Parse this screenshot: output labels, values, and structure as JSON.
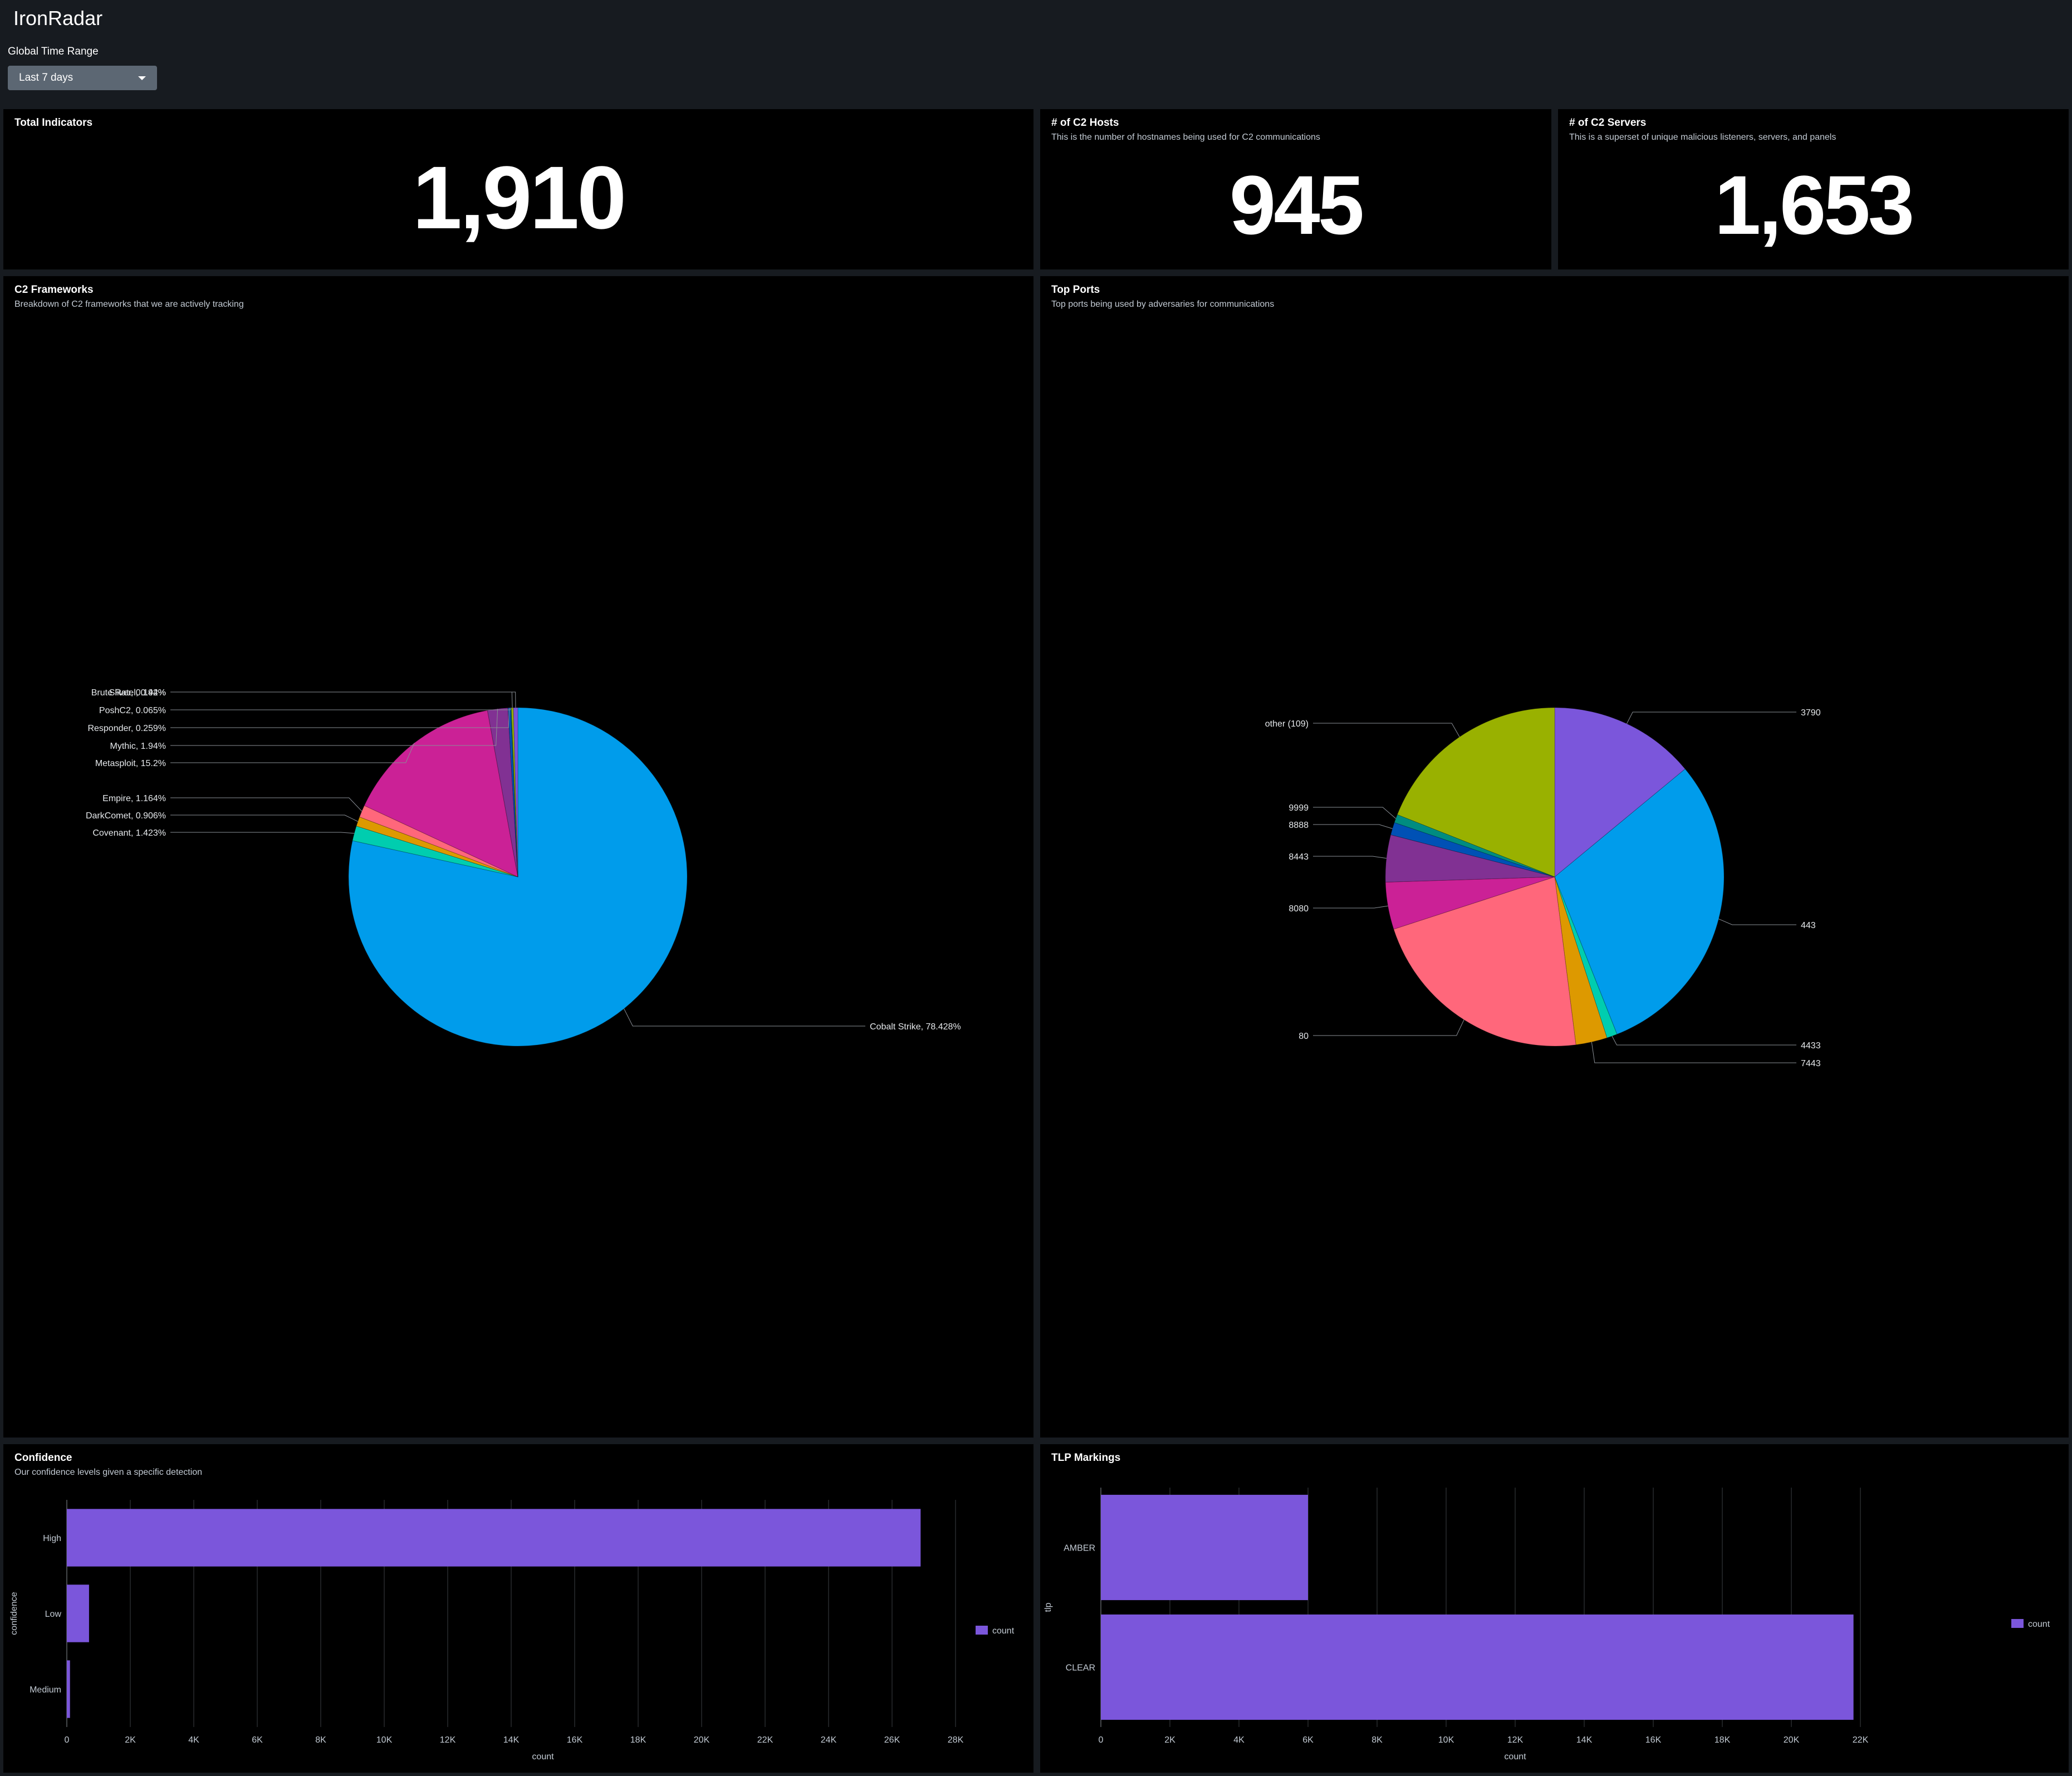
{
  "app": {
    "title": "IronRadar"
  },
  "time_range": {
    "label": "Global Time Range",
    "value": "Last 7 days"
  },
  "kpis": {
    "total_indicators": {
      "title": "Total Indicators",
      "value": "1,910"
    },
    "c2_hosts": {
      "title": "# of C2 Hosts",
      "description": "This is the number of hostnames being used for C2 communications",
      "value": "945"
    },
    "c2_servers": {
      "title": "# of C2 Servers",
      "description": "This is a superset of unique malicious listeners, servers, and panels",
      "value": "1,653"
    }
  },
  "panels": {
    "frameworks": {
      "title": "C2 Frameworks",
      "description": "Breakdown of C2 frameworks that we are actively tracking"
    },
    "ports": {
      "title": "Top Ports",
      "description": "Top ports being used by adversaries for communications"
    },
    "confidence": {
      "title": "Confidence",
      "description": "Our confidence levels given a specific detection"
    },
    "tlp": {
      "title": "TLP Markings"
    }
  },
  "chart_data": [
    {
      "id": "frameworks",
      "type": "pie",
      "slices": [
        {
          "label": "Cobalt Strike, 78.428%",
          "value": 78.428,
          "color": "#009ceb"
        },
        {
          "label": "Covenant, 1.423%",
          "value": 1.423,
          "color": "#00cdaf"
        },
        {
          "label": "DarkComet, 0.906%",
          "value": 0.906,
          "color": "#dd9900"
        },
        {
          "label": "Empire, 1.164%",
          "value": 1.164,
          "color": "#ff677b"
        },
        {
          "label": "Metasploit, 15.2%",
          "value": 15.2,
          "color": "#cb2196"
        },
        {
          "label": "Mythic, 1.94%",
          "value": 1.94,
          "color": "#813193"
        },
        {
          "label": "Responder, 0.259%",
          "value": 0.259,
          "color": "#0051b5"
        },
        {
          "label": "PoshC2, 0.065%",
          "value": 0.065,
          "color": "#008c80"
        },
        {
          "label": "Sliver, 0.194%",
          "value": 0.194,
          "color": "#99b100"
        },
        {
          "label": "Brute Ratel, 0.42%",
          "value": 0.42,
          "color": "#7b56db"
        }
      ]
    },
    {
      "id": "ports",
      "type": "pie",
      "slices": [
        {
          "label": "3790",
          "value": 14,
          "color": "#7b56db"
        },
        {
          "label": "443",
          "value": 30,
          "color": "#009ceb"
        },
        {
          "label": "4433",
          "value": 1,
          "color": "#00cdaf"
        },
        {
          "label": "7443",
          "value": 3,
          "color": "#dd9900"
        },
        {
          "label": "80",
          "value": 22,
          "color": "#ff677b"
        },
        {
          "label": "8080",
          "value": 4.5,
          "color": "#cb2196"
        },
        {
          "label": "8443",
          "value": 4.5,
          "color": "#813193"
        },
        {
          "label": "8888",
          "value": 1.2,
          "color": "#0051b5"
        },
        {
          "label": "9999",
          "value": 0.8,
          "color": "#008c80"
        },
        {
          "label": "other (109)",
          "value": 19,
          "color": "#99b100"
        }
      ]
    },
    {
      "id": "confidence",
      "type": "bar",
      "orientation": "horizontal",
      "categories": [
        "High",
        "Low",
        "Medium"
      ],
      "series": [
        {
          "name": "count",
          "values": [
            26900,
            700,
            100
          ]
        }
      ],
      "xlabel": "count",
      "ylabel": "confidence",
      "xlim": [
        0,
        30000
      ],
      "xticks": [
        0,
        2000,
        4000,
        6000,
        8000,
        10000,
        12000,
        14000,
        16000,
        18000,
        20000,
        22000,
        24000,
        26000,
        28000
      ],
      "xtick_labels": [
        "0",
        "2K",
        "4K",
        "6K",
        "8K",
        "10K",
        "12K",
        "14K",
        "16K",
        "18K",
        "20K",
        "22K",
        "24K",
        "26K",
        "28K"
      ],
      "legend": "right",
      "color": "#7b56db"
    },
    {
      "id": "tlp",
      "type": "bar",
      "orientation": "horizontal",
      "categories": [
        "AMBER",
        "CLEAR"
      ],
      "series": [
        {
          "name": "count",
          "values": [
            6000,
            21800
          ]
        }
      ],
      "xlabel": "count",
      "ylabel": "tlp",
      "xlim": [
        0,
        24000
      ],
      "xticks": [
        0,
        2000,
        4000,
        6000,
        8000,
        10000,
        12000,
        14000,
        16000,
        18000,
        20000,
        22000
      ],
      "xtick_labels": [
        "0",
        "2K",
        "4K",
        "6K",
        "8K",
        "10K",
        "12K",
        "14K",
        "16K",
        "18K",
        "20K",
        "22K"
      ],
      "legend": "right",
      "color": "#7b56db"
    }
  ]
}
